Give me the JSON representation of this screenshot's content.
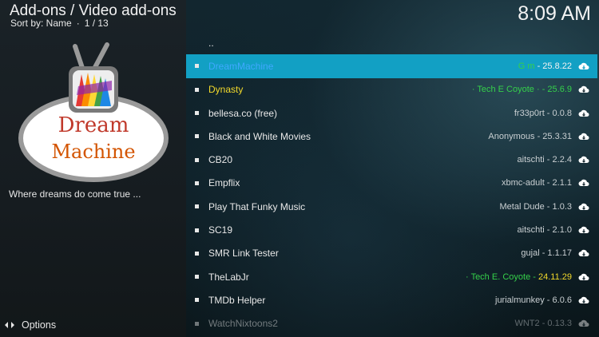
{
  "header": {
    "title": "Add-ons / Video add-ons",
    "sort_label": "Sort by: Name",
    "separator": "·",
    "position": "1 / 13",
    "clock": "8:09 AM"
  },
  "sidebar": {
    "logo_text_line1": "Dream",
    "logo_text_line2": "Machine",
    "description": "Where dreams do come true ...",
    "options_label": "Options"
  },
  "list": {
    "parent_label": "..",
    "items": [
      {
        "name": "DreamMachine",
        "meta": "- 25.8.22"
      },
      {
        "name": "Dynasty",
        "meta": "- 25.6.9"
      },
      {
        "name": "bellesa.co (free)",
        "meta": "fr33p0rt - 0.0.8"
      },
      {
        "name": "Black and White Movies",
        "meta": "Anonymous - 25.3.31"
      },
      {
        "name": "CB20",
        "meta": "aitschti - 2.2.4"
      },
      {
        "name": "Empflix",
        "meta": "xbmc-adult - 2.1.1"
      },
      {
        "name": "Play That Funky Music",
        "meta": "Metal Dude - 1.0.3"
      },
      {
        "name": "SC19",
        "meta": "aitschti - 2.1.0"
      },
      {
        "name": "SMR Link Tester",
        "meta": "gujal - 1.1.17"
      },
      {
        "name": "TheLabJr",
        "meta": "24.11.29"
      },
      {
        "name": "TMDb Helper",
        "meta": "jurialmunkey - 6.0.6"
      },
      {
        "name": "WatchNixtoons2",
        "meta": "WNT2 - 0.13.3"
      }
    ],
    "dreammachine_author": "G m",
    "dynasty_author": "· Tech E Coyote ·",
    "thelabjr_author_a": "· Tech E.",
    "thelabjr_author_b": "Coyote",
    "thelabjr_dash": "-"
  },
  "colors": {
    "selected_row": "#12a0c4",
    "author_green": "#35d04a",
    "dynasty_yellow": "#f2d92b"
  },
  "icons": {
    "row_status": "cloud-download-icon",
    "options": "options-arrows-icon"
  }
}
